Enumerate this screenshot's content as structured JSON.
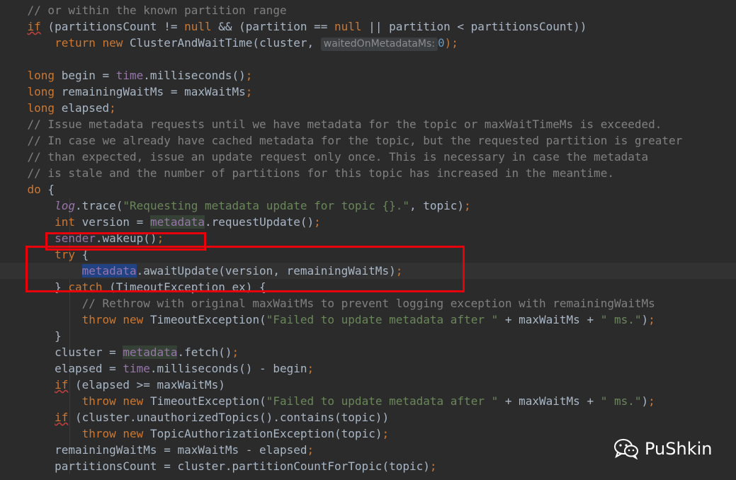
{
  "colors": {
    "background": "#2b2b2b",
    "keyword": "#cc7832",
    "comment": "#808080",
    "string": "#6a8759",
    "number": "#6897bb",
    "field": "#9876aa",
    "highlight_box": "#e8000b"
  },
  "code": {
    "l0": {
      "comment": "// or within the known partition range"
    },
    "l1": {
      "if": "if",
      "a": " (partitionsCount != ",
      "null1": "null",
      "b": " && (partition == ",
      "null2": "null",
      "c": " || partition < partitionsCount))"
    },
    "l2": {
      "return": "return",
      "sp": " ",
      "new": "new",
      "a": " ClusterAndWaitTime(cluster, ",
      "hint": "waitedOnMetadataMs:",
      "zero": "0",
      "end": ");"
    },
    "l4": {
      "type": "long",
      "a": " begin = ",
      "time": "time",
      "b": ".milliseconds()",
      "semi": ";"
    },
    "l5": {
      "type": "long",
      "a": " remainingWaitMs = maxWaitMs",
      "semi": ";"
    },
    "l6": {
      "type": "long",
      "a": " elapsed",
      "semi": ";"
    },
    "l7": {
      "comment": "// Issue metadata requests until we have metadata for the topic or maxWaitTimeMs is exceeded."
    },
    "l8": {
      "comment": "// In case we already have cached metadata for the topic, but the requested partition is greater"
    },
    "l9": {
      "comment": "// than expected, issue an update request only once. This is necessary in case the metadata"
    },
    "l10": {
      "comment": "// is stale and the number of partitions for this topic has increased in the meantime."
    },
    "l11": {
      "do": "do",
      "a": " {"
    },
    "l12": {
      "log": "log",
      "a": ".trace(",
      "str": "\"Requesting metadata update for topic {}.\"",
      "b": ", topic)",
      "semi": ";"
    },
    "l13": {
      "type": "int",
      "a": " version = ",
      "metadata": "metadata",
      "b": ".requestUpdate()",
      "semi": ";"
    },
    "l14": {
      "sender": "sender",
      "a": ".wakeup()",
      "semi": ";"
    },
    "l15": {
      "try": "try",
      "a": " {"
    },
    "l16": {
      "metadata": "metadata",
      "a": ".awaitUpdate(version, remainingWaitMs)",
      "semi": ";"
    },
    "l17": {
      "a": "} ",
      "catch": "catch",
      "b": " (TimeoutException ex) {"
    },
    "l18": {
      "comment": "// Rethrow with original maxWaitMs to prevent logging exception with remainingWaitMs"
    },
    "l19": {
      "throw": "throw",
      "sp": " ",
      "new": "new",
      "a": " TimeoutException(",
      "str": "\"Failed to update metadata after \"",
      "b": " + maxWaitMs + ",
      "str2": "\" ms.\"",
      "c": ")",
      "semi": ";"
    },
    "l20": {
      "a": "}"
    },
    "l21": {
      "a": "cluster = ",
      "metadata": "metadata",
      "b": ".fetch()",
      "semi": ";"
    },
    "l22": {
      "a": "elapsed = ",
      "time": "time",
      "b": ".milliseconds() - begin",
      "semi": ";"
    },
    "l23": {
      "if": "if",
      "a": " (elapsed >= maxWaitMs)"
    },
    "l24": {
      "throw": "throw",
      "sp": " ",
      "new": "new",
      "a": " TimeoutException(",
      "str": "\"Failed to update metadata after \"",
      "b": " + maxWaitMs + ",
      "str2": "\" ms.\"",
      "c": ")",
      "semi": ";"
    },
    "l25": {
      "if": "if",
      "a": " (cluster.unauthorizedTopics().contains(topic))"
    },
    "l26": {
      "throw": "throw",
      "sp": " ",
      "new": "new",
      "a": " TopicAuthorizationException(topic)",
      "semi": ";"
    },
    "l27": {
      "a": "remainingWaitMs = maxWaitMs - elapsed",
      "semi": ";"
    },
    "l28": {
      "a": "partitionsCount = cluster.partitionCountForTopic(topic)",
      "semi": ";"
    }
  },
  "watermark": {
    "icon": "wechat-icon",
    "text": "PuShkin"
  }
}
